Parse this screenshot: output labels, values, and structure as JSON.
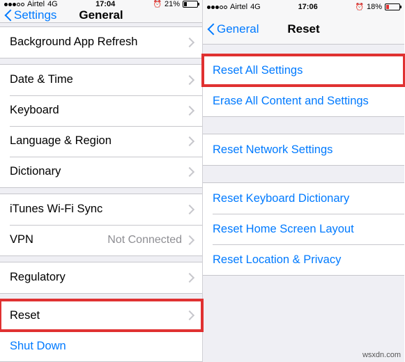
{
  "left": {
    "status": {
      "carrier": "Airtel",
      "net": "4G",
      "time": "17:04",
      "battery_pct": "21%"
    },
    "nav": {
      "back": "Settings",
      "title": "General"
    },
    "rows": {
      "background_app_refresh": "Background App Refresh",
      "date_time": "Date & Time",
      "keyboard": "Keyboard",
      "language_region": "Language & Region",
      "dictionary": "Dictionary",
      "itunes_wifi_sync": "iTunes Wi-Fi Sync",
      "vpn": "VPN",
      "vpn_value": "Not Connected",
      "regulatory": "Regulatory",
      "reset": "Reset",
      "shut_down": "Shut Down"
    }
  },
  "right": {
    "status": {
      "carrier": "Airtel",
      "net": "4G",
      "time": "17:06",
      "battery_pct": "18%"
    },
    "nav": {
      "back": "General",
      "title": "Reset"
    },
    "rows": {
      "reset_all": "Reset All Settings",
      "erase_all": "Erase All Content and Settings",
      "reset_network": "Reset Network Settings",
      "reset_keyboard_dict": "Reset Keyboard Dictionary",
      "reset_home_layout": "Reset Home Screen Layout",
      "reset_location_privacy": "Reset Location & Privacy"
    }
  },
  "watermark": "wsxdn.com"
}
